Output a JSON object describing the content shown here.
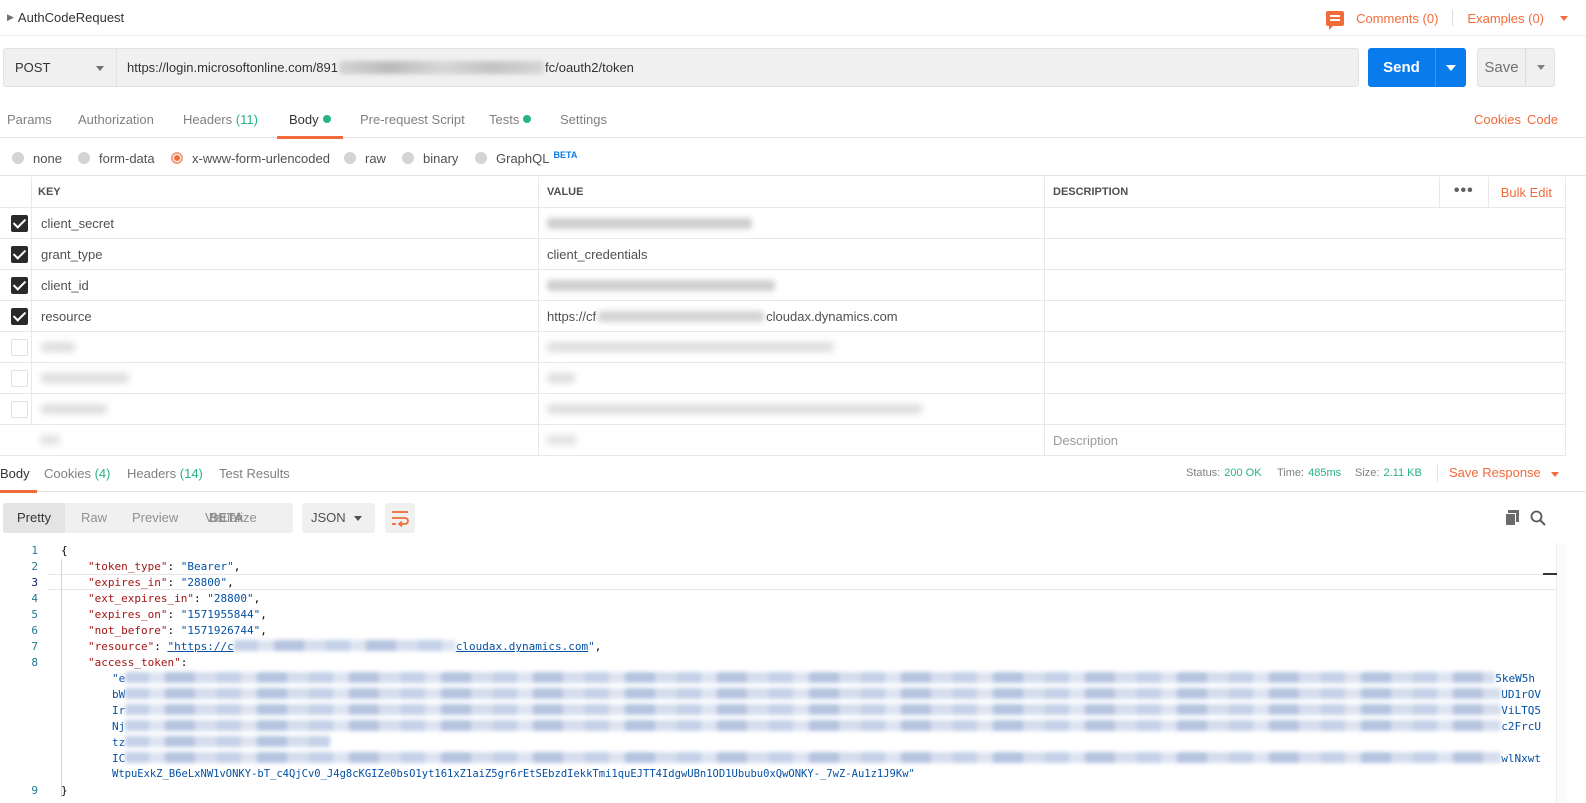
{
  "request": {
    "name": "AuthCodeRequest",
    "comments_label": "Comments (0)",
    "examples_label": "Examples (0)",
    "method": "POST",
    "url_prefix": "https://login.microsoftonline.com/891",
    "url_suffix": "fc/oauth2/token",
    "send_label": "Send",
    "save_label": "Save"
  },
  "request_tabs": {
    "params": "Params",
    "authorization": "Authorization",
    "headers": "Headers",
    "headers_count": "(11)",
    "body": "Body",
    "prerequest": "Pre-request Script",
    "tests": "Tests",
    "settings": "Settings",
    "cookies_link": "Cookies",
    "code_link": "Code"
  },
  "body_types": {
    "none": "none",
    "form_data": "form-data",
    "urlencoded": "x-www-form-urlencoded",
    "raw": "raw",
    "binary": "binary",
    "graphql": "GraphQL",
    "beta": "BETA",
    "selected": "x-www-form-urlencoded"
  },
  "params_table": {
    "headers": {
      "key": "KEY",
      "value": "VALUE",
      "description": "DESCRIPTION",
      "bulk_edit": "Bulk Edit"
    },
    "rows": [
      {
        "key": "client_secret",
        "value": "",
        "checked": true
      },
      {
        "key": "grant_type",
        "value": "client_credentials",
        "checked": true
      },
      {
        "key": "client_id",
        "value": "",
        "checked": true
      },
      {
        "key": "resource",
        "value_prefix": "https://cf",
        "value_suffix": "cloudax.dynamics.com",
        "checked": true
      },
      {
        "key": "",
        "value": "",
        "checked": false
      },
      {
        "key": "",
        "value": "",
        "checked": false
      },
      {
        "key": "",
        "value": "",
        "checked": false
      }
    ],
    "new_row_placeholder": "Description"
  },
  "response": {
    "tabs": {
      "body": "Body",
      "cookies": "Cookies",
      "cookies_count": "(4)",
      "headers": "Headers",
      "headers_count": "(14)",
      "test_results": "Test Results"
    },
    "status_label": "Status:",
    "status_value": "200 OK",
    "time_label": "Time:",
    "time_value": "485ms",
    "size_label": "Size:",
    "size_value": "2.11 KB",
    "save_response": "Save Response",
    "view_modes": {
      "pretty": "Pretty",
      "raw": "Raw",
      "preview": "Preview",
      "visualize": "Visualize",
      "beta": "BETA"
    },
    "format": "JSON"
  },
  "code": {
    "line_numbers": [
      "1",
      "2",
      "3",
      "4",
      "5",
      "6",
      "7",
      "8",
      "9"
    ],
    "open_brace": "{",
    "close_brace": "}",
    "fields": {
      "token_type_key": "\"token_type\"",
      "token_type_val": "\"Bearer\"",
      "expires_in_key": "\"expires_in\"",
      "expires_in_val": "\"28800\"",
      "ext_expires_in_key": "\"ext_expires_in\"",
      "ext_expires_in_val": "\"28800\"",
      "expires_on_key": "\"expires_on\"",
      "expires_on_val": "\"1571955844\"",
      "not_before_key": "\"not_before\"",
      "not_before_val": "\"1571926744\"",
      "resource_key": "\"resource\"",
      "resource_prefix": "\"https://c",
      "resource_suffix": "cloudax.dynamics.com",
      "access_token_key": "\"access_token\""
    },
    "token_lines": [
      {
        "start": "\"e",
        "end": "5keW5h"
      },
      {
        "start": "bW",
        "end": "UD1rOV"
      },
      {
        "start": "Ir",
        "end": "ViLTQ5"
      },
      {
        "start": "Nj",
        "end": "c2FrcU"
      },
      {
        "start": "tz",
        "end": ""
      },
      {
        "start": "IC",
        "end": "wlNxwt"
      },
      {
        "start": "WtpuExkZ_B6eLxNW1vONKY-bT_c4QjCv0_J4g8cKGIZe0bsO1yt161xZ1aiZ5gr6rEtSEbzdIekkTmi1quEJTT4IdgwUBn1OD1Ububu0xQwONKY-_7wZ-Au1z1J9Kw\"",
        "end": ""
      }
    ]
  }
}
